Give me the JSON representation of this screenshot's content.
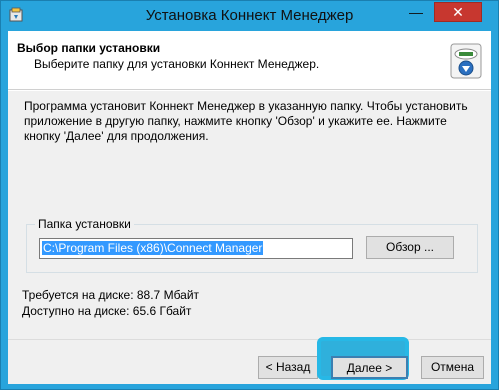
{
  "window": {
    "title": "Установка Коннект Менеджер",
    "minimize_glyph": "—",
    "close_glyph": "✕"
  },
  "header": {
    "title": "Выбор папки установки",
    "subtitle": "Выберите папку для установки Коннект Менеджер."
  },
  "description": "Программа установит Коннект Менеджер в указанную папку. Чтобы установить приложение в другую папку, нажмите кнопку 'Обзор' и укажите ее. Нажмите кнопку 'Далее' для продолжения.",
  "install_folder": {
    "label": "Папка установки",
    "path": "C:\\Program Files (x86)\\Connect Manager",
    "browse_label": "Обзор ..."
  },
  "disk": {
    "required": "Требуется на диске: 88.7 Мбайт",
    "available": "Доступно на диске: 65.6 Гбайт"
  },
  "buttons": {
    "back": "< Назад",
    "next": "Далее >",
    "cancel": "Отмена"
  },
  "colors": {
    "title_bar": "#28a4dc",
    "close_button": "#c7372f",
    "selection": "#3399ff",
    "highlight": "#27b8e6"
  },
  "icons": {
    "app": "installer-icon",
    "logo": "connect-manager-logo-icon"
  }
}
